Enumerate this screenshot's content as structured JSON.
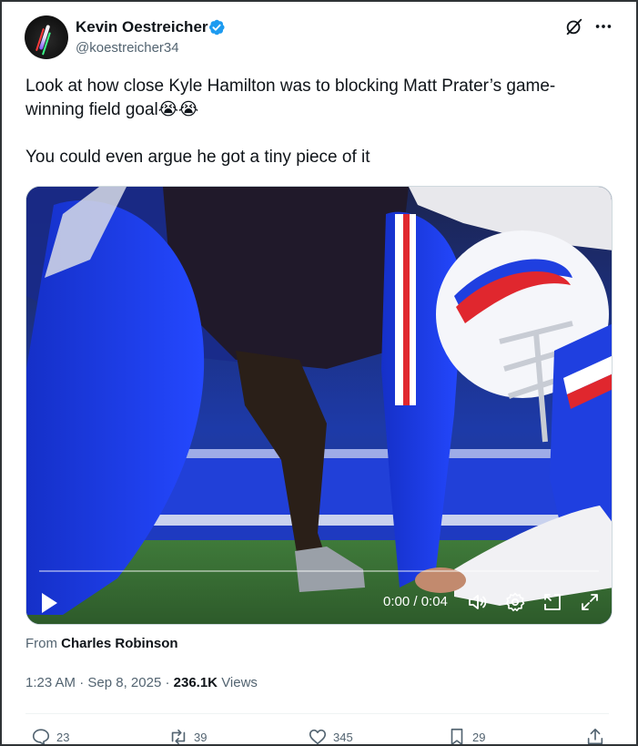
{
  "author": {
    "display_name": "Kevin Oestreicher",
    "handle": "@koestreicher34",
    "verified": true,
    "verified_color": "#1d9bf0"
  },
  "header_icons": [
    "grok-icon",
    "more-icon"
  ],
  "tweet": {
    "line1": "Look at how close Kyle Hamilton was to blocking Matt Prater’s game-winning field goal😭😭",
    "line2": "You could even argue he got a tiny piece of it"
  },
  "video": {
    "time": "0:00 / 0:04",
    "progress": 0,
    "controls": [
      "play-icon",
      "volume-icon",
      "settings-icon",
      "picture-in-picture-icon",
      "fullscreen-icon"
    ]
  },
  "attribution": {
    "prefix": "From",
    "name": "Charles Robinson"
  },
  "meta": {
    "time": "1:23 AM",
    "separator": "·",
    "date": "Sep 8, 2025",
    "views_count": "236.1K",
    "views_label": "Views"
  },
  "actions": {
    "replies": "23",
    "reposts": "39",
    "likes": "345",
    "bookmarks": "29"
  },
  "colors": {
    "text": "#0f1419",
    "secondary": "#536471",
    "accent": "#1d9bf0",
    "bills_blue": "#1f3fe0",
    "bills_red": "#e0272e"
  }
}
